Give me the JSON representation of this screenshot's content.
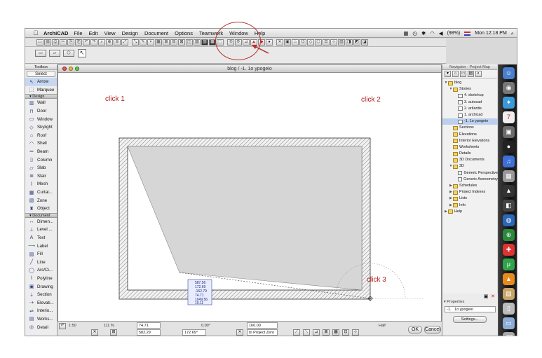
{
  "menubar": {
    "app": "ArchiCAD",
    "items": [
      "File",
      "Edit",
      "View",
      "Design",
      "Document",
      "Options",
      "Teamwork",
      "Window",
      "Help"
    ],
    "battery": "(98%)",
    "clock": "Mon 12:18 PM"
  },
  "toolbox": {
    "title": "Toolbox",
    "select_label": "Select",
    "arrow": "Arrow",
    "marquee": "Marquee",
    "design_group": "Design",
    "design_tools": [
      "Wall",
      "Door",
      "Window",
      "Skylight",
      "Roof",
      "Shell",
      "Beam",
      "Column",
      "Slab",
      "Stair",
      "Mesh",
      "Curtai...",
      "Zone",
      "Object"
    ],
    "document_group": "Document",
    "document_tools": [
      "Dimen...",
      "Level ...",
      "Text",
      "Label",
      "Fill",
      "Line",
      "Arc/Ci...",
      "Polyline",
      "Drawing",
      "Section",
      "Elevati...",
      "Interio...",
      "Works...",
      "Detail"
    ]
  },
  "drawing_window": {
    "title": "blog / -1. 1o ypogeio"
  },
  "annotations": {
    "click1": "click 1",
    "click2": "click 2",
    "click3": "click 3"
  },
  "tracker": {
    "rows": [
      "587.56",
      "172.69",
      "-162.79",
      "74.71",
      "1049.56",
      "10.11"
    ]
  },
  "statusbar": {
    "scale": "1:50",
    "zoom": "111 %",
    "angle": "0.00°",
    "coord_x": "582.29",
    "coord_y": "74.71",
    "coord_r": "172.69°",
    "ref_value": "160.00",
    "ref_label": "to Project Zero",
    "half_label": "Half",
    "ok": "OK",
    "cancel": "Cancel"
  },
  "navigator": {
    "title": "Navigator - Project Map",
    "tree": [
      {
        "label": "blog",
        "level": 0,
        "tw": "▼"
      },
      {
        "label": "Stories",
        "level": 1,
        "tw": "▼"
      },
      {
        "label": "4. sketchup",
        "level": 2,
        "tw": ""
      },
      {
        "label": "3. autocad",
        "level": 2,
        "tw": ""
      },
      {
        "label": "2. artlantis",
        "level": 2,
        "tw": ""
      },
      {
        "label": "1. archicad",
        "level": 2,
        "tw": ""
      },
      {
        "label": "-1. 1o ypogeio",
        "level": 2,
        "tw": "",
        "selected": true
      },
      {
        "label": "Sections",
        "level": 1,
        "tw": ""
      },
      {
        "label": "Elevations",
        "level": 1,
        "tw": ""
      },
      {
        "label": "Interior Elevations",
        "level": 1,
        "tw": ""
      },
      {
        "label": "Worksheets",
        "level": 1,
        "tw": ""
      },
      {
        "label": "Details",
        "level": 1,
        "tw": ""
      },
      {
        "label": "3D Documents",
        "level": 1,
        "tw": ""
      },
      {
        "label": "3D",
        "level": 1,
        "tw": "▼"
      },
      {
        "label": "Generic Perspective",
        "level": 2,
        "tw": ""
      },
      {
        "label": "Generic Axonometry",
        "level": 2,
        "tw": ""
      },
      {
        "label": "Schedules",
        "level": 1,
        "tw": "▶"
      },
      {
        "label": "Project Indexes",
        "level": 1,
        "tw": "▶"
      },
      {
        "label": "Lists",
        "level": 1,
        "tw": "▶"
      },
      {
        "label": "Info",
        "level": 1,
        "tw": "▶"
      },
      {
        "label": "Help",
        "level": 0,
        "tw": "▶"
      }
    ],
    "properties_label": "Properties",
    "properties_id": "-1.",
    "properties_value": "1o ypogeio",
    "settings": "Settings..."
  },
  "colors": {
    "annotation": "#b01e1e",
    "selection": "#bcd0ee",
    "hatch": "#8a8a8a",
    "slab_fill": "#d6d6d6"
  }
}
